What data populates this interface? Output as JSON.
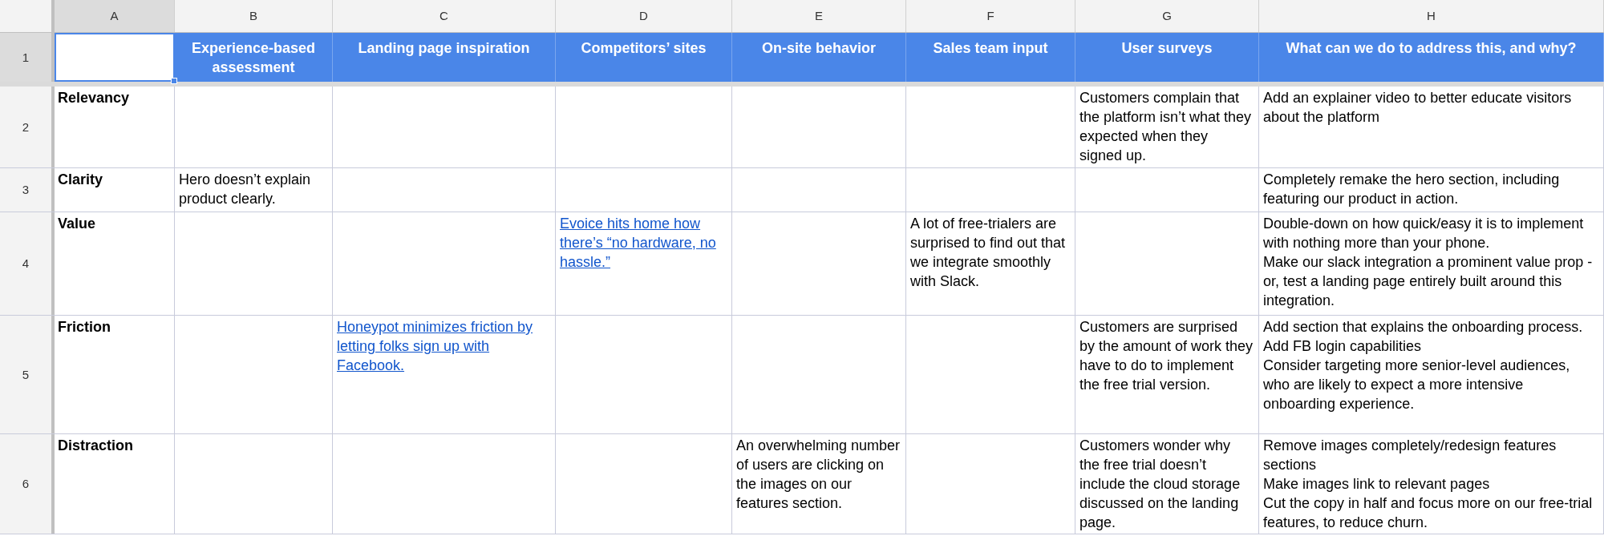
{
  "columns": [
    "A",
    "B",
    "C",
    "D",
    "E",
    "F",
    "G",
    "H"
  ],
  "header_row": {
    "number": "1",
    "label_cell_selected": true,
    "cells": [
      "Experience-based assessment",
      "Landing page inspiration",
      "Competitors’ sites",
      "On-site behavior",
      "Sales team input",
      "User surveys",
      "What can we do to address this, and why?"
    ]
  },
  "rows": [
    {
      "number": "2",
      "label": "Relevancy",
      "cells": [
        {
          "kind": "empty"
        },
        {
          "kind": "empty"
        },
        {
          "kind": "empty"
        },
        {
          "kind": "empty"
        },
        {
          "kind": "empty"
        },
        {
          "kind": "text",
          "text": "Customers complain that the platform isn’t what they expected when they signed up."
        },
        {
          "kind": "text",
          "text": "Add an explainer video to better educate visitors about the platform"
        }
      ]
    },
    {
      "number": "3",
      "label": "Clarity",
      "cells": [
        {
          "kind": "text",
          "text": "Hero doesn’t explain product clearly."
        },
        {
          "kind": "empty"
        },
        {
          "kind": "empty"
        },
        {
          "kind": "empty"
        },
        {
          "kind": "empty"
        },
        {
          "kind": "empty"
        },
        {
          "kind": "text",
          "text": "Completely remake the hero section, including featuring our product in action."
        }
      ]
    },
    {
      "number": "4",
      "label": "Value",
      "cells": [
        {
          "kind": "empty"
        },
        {
          "kind": "empty"
        },
        {
          "kind": "link",
          "text": "Evoice hits home how there’s “no hardware, no hassle.”"
        },
        {
          "kind": "empty"
        },
        {
          "kind": "text",
          "text": "A lot of free-trialers are surprised to find out that we integrate smoothly with Slack."
        },
        {
          "kind": "empty"
        },
        {
          "kind": "text",
          "text": "Double-down on how quick/easy it is to implement with nothing more than your phone.\nMake our slack integration a prominent value prop - or, test a landing page entirely built around this integration."
        }
      ]
    },
    {
      "number": "5",
      "label": "Friction",
      "cells": [
        {
          "kind": "empty"
        },
        {
          "kind": "link",
          "text": "Honeypot minimizes friction by letting folks sign up with Facebook."
        },
        {
          "kind": "empty"
        },
        {
          "kind": "empty"
        },
        {
          "kind": "empty"
        },
        {
          "kind": "text",
          "text": "Customers are surprised by the amount of work they have to do to implement the free trial version."
        },
        {
          "kind": "text",
          "text": "Add section that explains the onboarding process.\nAdd FB login capabilities\nConsider targeting more senior-level audiences, who are likely to expect a more intensive onboarding experience."
        }
      ]
    },
    {
      "number": "6",
      "label": "Distraction",
      "cells": [
        {
          "kind": "empty"
        },
        {
          "kind": "empty"
        },
        {
          "kind": "empty"
        },
        {
          "kind": "text",
          "text": "An overwhelming number of users are clicking on the images on our features section."
        },
        {
          "kind": "empty"
        },
        {
          "kind": "text",
          "text": "Customers wonder why the free trial doesn’t include the cloud storage discussed on the landing page."
        },
        {
          "kind": "text",
          "text": "Remove images completely/redesign features sections\nMake images link to relevant pages\nCut the copy in half and focus more on our free-trial features, to reduce churn."
        }
      ]
    }
  ]
}
